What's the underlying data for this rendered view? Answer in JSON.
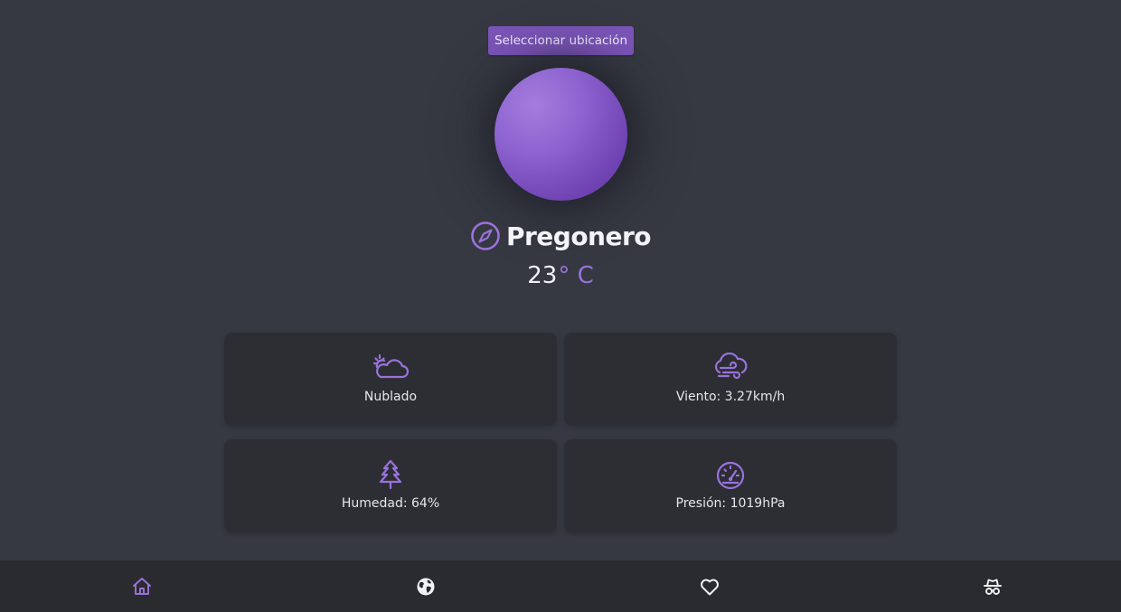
{
  "header": {
    "select_location_label": "Seleccionar ubicación"
  },
  "location": {
    "city": "Pregonero",
    "icon": "compass-icon"
  },
  "temperature": {
    "value": "23",
    "unit": "° C"
  },
  "cards": [
    {
      "icon": "cloud-sun-icon",
      "label": "Nublado"
    },
    {
      "icon": "wind-cloud-icon",
      "label": "Viento: 3.27km/h"
    },
    {
      "icon": "tree-icon",
      "label": "Humedad: 64%"
    },
    {
      "icon": "gauge-icon",
      "label": "Presión: 1019hPa"
    }
  ],
  "nav": [
    {
      "icon": "home-icon",
      "active": true
    },
    {
      "icon": "globe-icon",
      "active": false
    },
    {
      "icon": "heart-icon",
      "active": false
    },
    {
      "icon": "spy-icon",
      "active": false
    }
  ],
  "colors": {
    "background": "#363942",
    "accent": "#7b55b8",
    "card": "#2c2e33",
    "navbar": "#2a2b2f"
  }
}
